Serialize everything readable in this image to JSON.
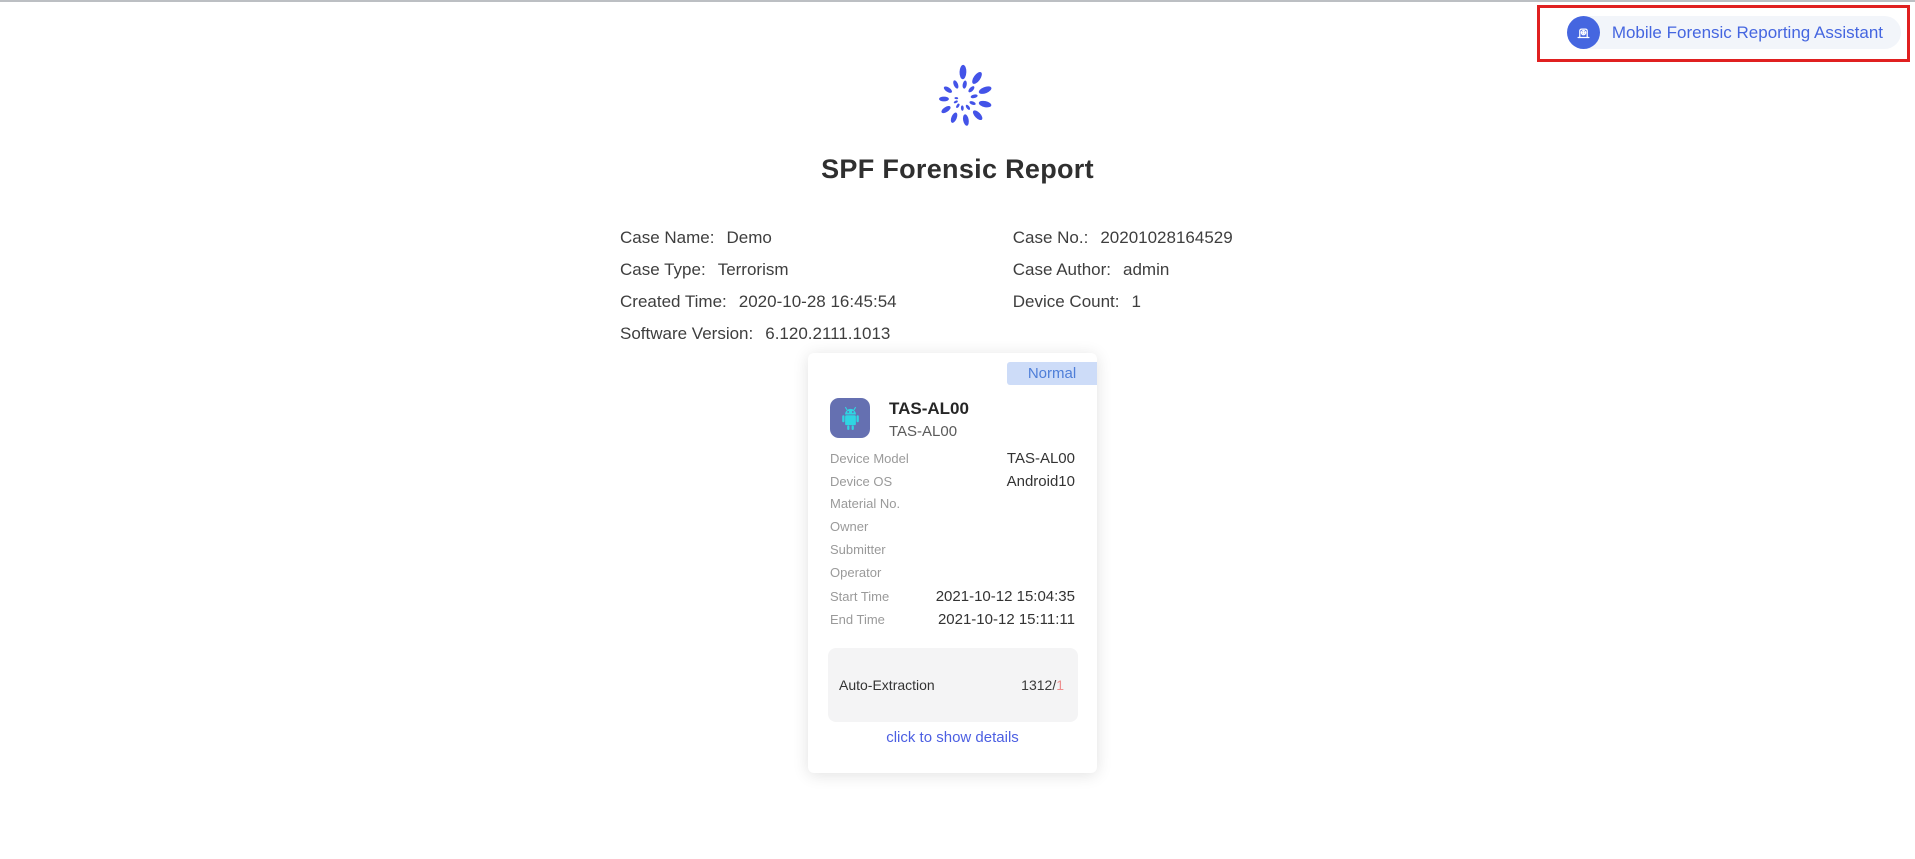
{
  "header": {
    "assistant_button_label": "Mobile Forensic Reporting Assistant"
  },
  "page_title": "SPF Forensic Report",
  "case_info": {
    "rows": [
      {
        "left_label": "Case Name:",
        "left_value": "Demo",
        "right_label": "Case No.:",
        "right_value": "20201028164529"
      },
      {
        "left_label": "Case Type:",
        "left_value": "Terrorism",
        "right_label": "Case Author:",
        "right_value": "admin"
      },
      {
        "left_label": "Created Time:",
        "left_value": "2020-10-28 16:45:54",
        "right_label": "Device Count:",
        "right_value": "1"
      },
      {
        "left_label": "Software Version:",
        "left_value": "6.120.2111.1013",
        "right_label": "",
        "right_value": ""
      }
    ]
  },
  "device_card": {
    "status_badge": "Normal",
    "device_name": "TAS-AL00",
    "device_subname": "TAS-AL00",
    "fields": [
      {
        "label": "Device Model",
        "value": "TAS-AL00"
      },
      {
        "label": "Device OS",
        "value": "Android10"
      },
      {
        "label": "Material No.",
        "value": ""
      },
      {
        "label": "Owner",
        "value": ""
      },
      {
        "label": "Submitter",
        "value": ""
      },
      {
        "label": "Operator",
        "value": ""
      },
      {
        "label": "Start Time",
        "value": "2021-10-12 15:04:35"
      },
      {
        "label": "End Time",
        "value": "2021-10-12 15:11:11"
      }
    ],
    "extraction": {
      "label": "Auto-Extraction",
      "count": "1312",
      "separator": "/",
      "total": "1"
    },
    "details_link": "click to show details"
  },
  "icons": {
    "assistant": "mobile-device-download-icon",
    "device": "android-robot-icon",
    "logo": "spiral-logo"
  },
  "colors": {
    "primary_blue": "#4566e0",
    "badge_bg": "#cddcf8",
    "badge_text": "#4e7ed8",
    "red_annotation": "#e02020",
    "device_icon_bg": "#6570b1",
    "android_teal": "#2fd5e2",
    "link_blue": "#4c5fe2",
    "extraction_total": "#ee8f8f",
    "logo_blue": "#4353e8"
  }
}
